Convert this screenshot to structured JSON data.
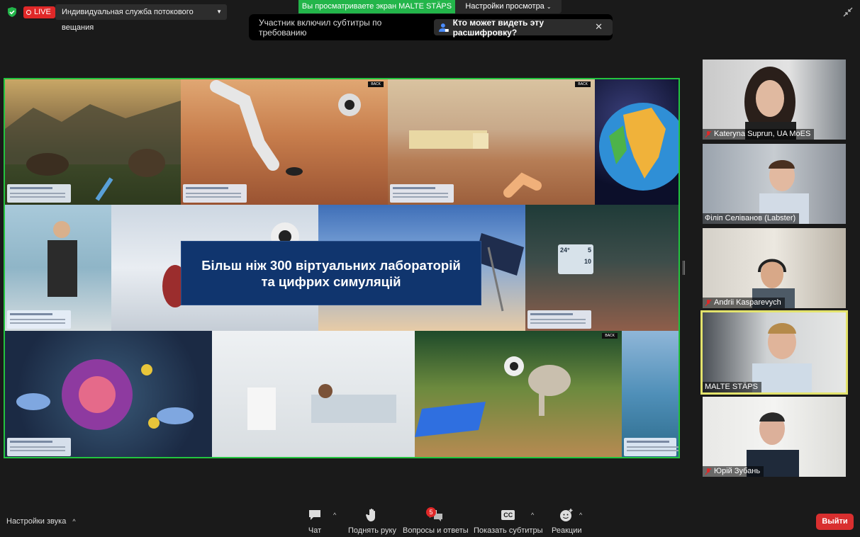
{
  "topbar": {
    "live_label": "LIVE",
    "stream_service": "Индивидуальная служба потокового вещания",
    "viewing_label": "Вы просматриваете экран MALTE STÄPS",
    "view_settings_label": "Настройки просмотра",
    "colors": {
      "live": "#e02828",
      "viewing": "#23b54a"
    }
  },
  "caption_banner": {
    "text": "Участник включил субтитры по требованию",
    "who_can_see": "Кто может видеть эту расшифровку?"
  },
  "shared_screen": {
    "title_line1": "Більш ніж 300 віртуальних лабораторій",
    "title_line2": "та цифрих симуляцій",
    "back_label": "BACK",
    "lab_hud": {
      "temperature": "24°",
      "count_top": "5",
      "count_bottom": "10"
    }
  },
  "participants": [
    {
      "name": "Kateryna Suprun, UA MoES",
      "muted": true
    },
    {
      "name": "Філіп Селіванов (Labster)",
      "muted": false
    },
    {
      "name": "Andrii Kasparevych",
      "muted": true
    },
    {
      "name": "MALTE STÄPS",
      "muted": false,
      "speaking": true
    },
    {
      "name": "Юрій Зубань",
      "muted": true
    }
  ],
  "bottom": {
    "audio_settings": "Настройки звука",
    "chat": "Чат",
    "raise_hand": "Поднять руку",
    "qa": "Вопросы и ответы",
    "qa_badge": "5",
    "captions": "Показать субтитры",
    "captions_icon": "CC",
    "reactions": "Реакции",
    "leave": "Выйти"
  }
}
